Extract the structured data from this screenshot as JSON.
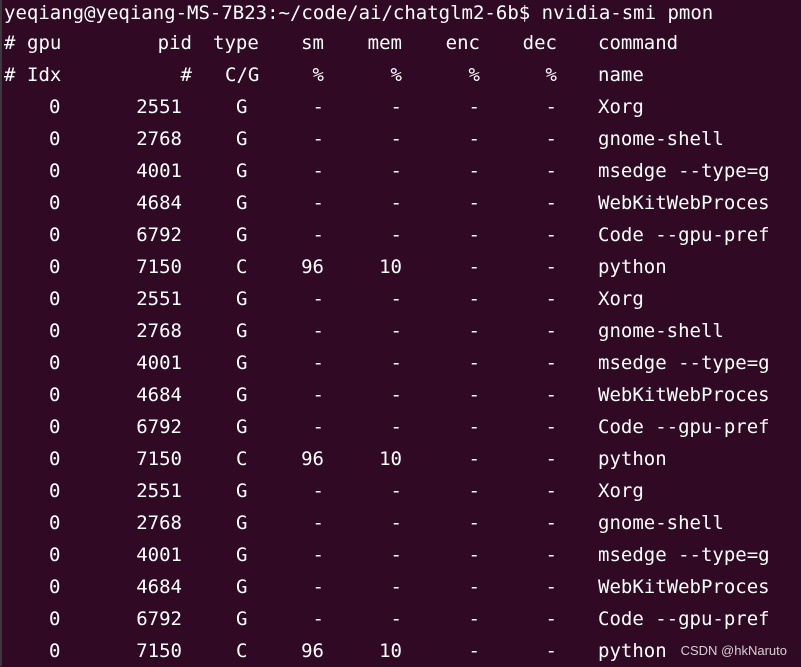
{
  "terminal": {
    "background": "#300a24",
    "foreground": "#ffffff",
    "prompt": "yeqiang@yeqiang-MS-7B23:~/code/ai/chatglm2-6b$ nvidia-smi pmon",
    "header1": {
      "hash": "#",
      "gpu": "gpu",
      "pid": "pid",
      "type": "type",
      "sm": "sm",
      "mem": "mem",
      "enc": "enc",
      "dec": "dec",
      "command": "command"
    },
    "header2": {
      "hash": "#",
      "gpu": "Idx",
      "pid": "#",
      "type": "C/G",
      "sm": "%",
      "mem": "%",
      "enc": "%",
      "dec": "%",
      "command": "name"
    },
    "rows": [
      {
        "gpu": "0",
        "pid": "2551",
        "type": "G",
        "sm": "-",
        "mem": "-",
        "enc": "-",
        "dec": "-",
        "command": "Xorg"
      },
      {
        "gpu": "0",
        "pid": "2768",
        "type": "G",
        "sm": "-",
        "mem": "-",
        "enc": "-",
        "dec": "-",
        "command": "gnome-shell"
      },
      {
        "gpu": "0",
        "pid": "4001",
        "type": "G",
        "sm": "-",
        "mem": "-",
        "enc": "-",
        "dec": "-",
        "command": "msedge --type=g"
      },
      {
        "gpu": "0",
        "pid": "4684",
        "type": "G",
        "sm": "-",
        "mem": "-",
        "enc": "-",
        "dec": "-",
        "command": "WebKitWebProces"
      },
      {
        "gpu": "0",
        "pid": "6792",
        "type": "G",
        "sm": "-",
        "mem": "-",
        "enc": "-",
        "dec": "-",
        "command": "Code --gpu-pref"
      },
      {
        "gpu": "0",
        "pid": "7150",
        "type": "C",
        "sm": "96",
        "mem": "10",
        "enc": "-",
        "dec": "-",
        "command": "python"
      },
      {
        "gpu": "0",
        "pid": "2551",
        "type": "G",
        "sm": "-",
        "mem": "-",
        "enc": "-",
        "dec": "-",
        "command": "Xorg"
      },
      {
        "gpu": "0",
        "pid": "2768",
        "type": "G",
        "sm": "-",
        "mem": "-",
        "enc": "-",
        "dec": "-",
        "command": "gnome-shell"
      },
      {
        "gpu": "0",
        "pid": "4001",
        "type": "G",
        "sm": "-",
        "mem": "-",
        "enc": "-",
        "dec": "-",
        "command": "msedge --type=g"
      },
      {
        "gpu": "0",
        "pid": "4684",
        "type": "G",
        "sm": "-",
        "mem": "-",
        "enc": "-",
        "dec": "-",
        "command": "WebKitWebProces"
      },
      {
        "gpu": "0",
        "pid": "6792",
        "type": "G",
        "sm": "-",
        "mem": "-",
        "enc": "-",
        "dec": "-",
        "command": "Code --gpu-pref"
      },
      {
        "gpu": "0",
        "pid": "7150",
        "type": "C",
        "sm": "96",
        "mem": "10",
        "enc": "-",
        "dec": "-",
        "command": "python"
      },
      {
        "gpu": "0",
        "pid": "2551",
        "type": "G",
        "sm": "-",
        "mem": "-",
        "enc": "-",
        "dec": "-",
        "command": "Xorg"
      },
      {
        "gpu": "0",
        "pid": "2768",
        "type": "G",
        "sm": "-",
        "mem": "-",
        "enc": "-",
        "dec": "-",
        "command": "gnome-shell"
      },
      {
        "gpu": "0",
        "pid": "4001",
        "type": "G",
        "sm": "-",
        "mem": "-",
        "enc": "-",
        "dec": "-",
        "command": "msedge --type=g"
      },
      {
        "gpu": "0",
        "pid": "4684",
        "type": "G",
        "sm": "-",
        "mem": "-",
        "enc": "-",
        "dec": "-",
        "command": "WebKitWebProces"
      },
      {
        "gpu": "0",
        "pid": "6792",
        "type": "G",
        "sm": "-",
        "mem": "-",
        "enc": "-",
        "dec": "-",
        "command": "Code --gpu-pref"
      },
      {
        "gpu": "0",
        "pid": "7150",
        "type": "C",
        "sm": "96",
        "mem": "10",
        "enc": "-",
        "dec": "-",
        "command": "python"
      }
    ]
  },
  "watermark": "CSDN @hkNaruto"
}
